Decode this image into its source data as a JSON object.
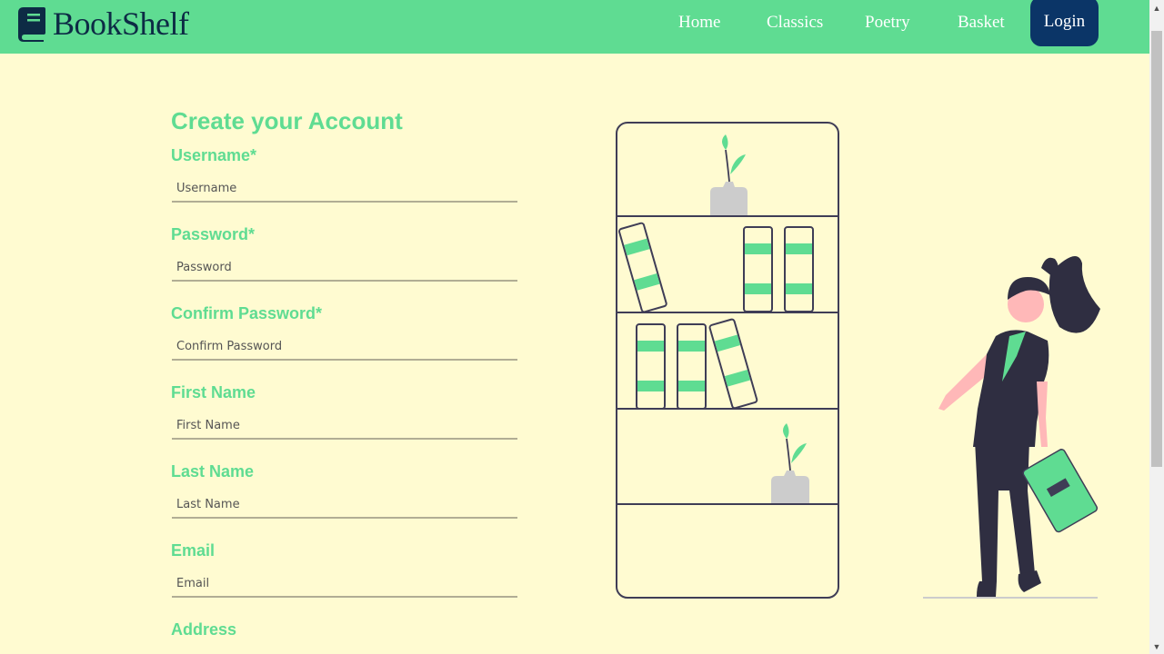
{
  "navbar": {
    "brand": "BookShelf",
    "links": [
      "Home",
      "Classics",
      "Poetry",
      "Basket"
    ],
    "login": "Login"
  },
  "form": {
    "title": "Create your Account",
    "fields": [
      {
        "label": "Username*",
        "placeholder": "Username"
      },
      {
        "label": "Password*",
        "placeholder": "Password"
      },
      {
        "label": "Confirm Password*",
        "placeholder": "Confirm Password"
      },
      {
        "label": "First Name",
        "placeholder": "First Name"
      },
      {
        "label": "Last Name",
        "placeholder": "Last Name"
      },
      {
        "label": "Email",
        "placeholder": "Email"
      },
      {
        "label": "Address"
      }
    ]
  },
  "colors": {
    "navbar": "#5fdc92",
    "accent": "#5fdc92",
    "background": "#fffbd1",
    "brand_text": "#0d2b45",
    "login_button": "#0b3567"
  },
  "icons": {
    "brand": "book-icon",
    "scroll_up": "scroll-up-arrow-icon",
    "scroll_down": "scroll-down-arrow-icon"
  }
}
